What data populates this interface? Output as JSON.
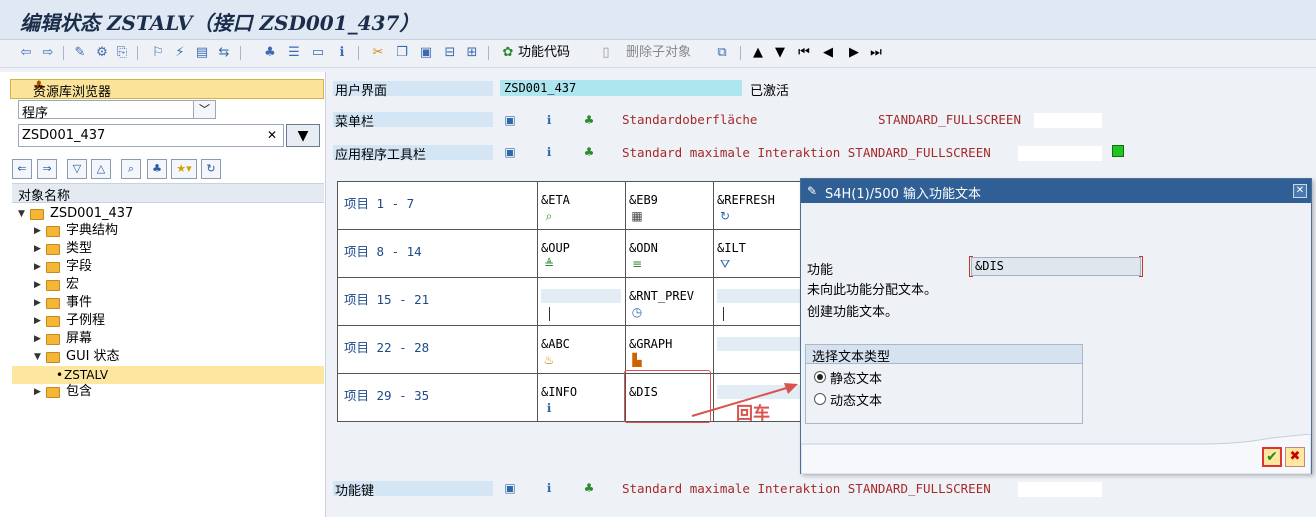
{
  "window": {
    "title": "编辑状态 ZSTALV（接口 ZSD001_437）"
  },
  "toolbar": {
    "function_code_label": "功能代码",
    "delete_child_label": "删除子对象"
  },
  "left": {
    "repo_browser_label": "资源库浏览器",
    "object_type": "程序",
    "object_name": "ZSD001_437",
    "tree_header": "对象名称",
    "tree": [
      {
        "label": "ZSD001_437"
      },
      {
        "label": "字典结构"
      },
      {
        "label": "类型"
      },
      {
        "label": "字段"
      },
      {
        "label": "宏"
      },
      {
        "label": "事件"
      },
      {
        "label": "子例程"
      },
      {
        "label": "屏幕"
      },
      {
        "label": "GUI 状态"
      },
      {
        "label": "ZSTALV"
      },
      {
        "label": "包含"
      }
    ]
  },
  "main": {
    "ui_label": "用户界面",
    "ui_value": "ZSD001_437",
    "ui_status": "已激活",
    "menubar_label": "菜单栏",
    "menubar_text": "Standardoberfläche",
    "menubar_code": "STANDARD_FULLSCREEN",
    "apptoolbar_label": "应用程序工具栏",
    "apptoolbar_text": "Standard maximale Interaktion STANDARD_FULLSCREEN",
    "funckeys_label": "功能键",
    "funckeys_text": "Standard maximale Interaktion STANDARD_FULLSCREEN"
  },
  "grid": {
    "rows": [
      {
        "label": "项目  1 -  7",
        "c1": "&ETA",
        "c2": "&EB9",
        "c3": "&REFRESH"
      },
      {
        "label": "项目  8 - 14",
        "c1": "&OUP",
        "c2": "&ODN",
        "c3": "&ILT"
      },
      {
        "label": "项目 15 - 21",
        "c1": "",
        "c2": "&RNT_PREV",
        "c3": ""
      },
      {
        "label": "项目 22 - 28",
        "c1": "&ABC",
        "c2": "&GRAPH",
        "c3": ""
      },
      {
        "label": "项目 29 - 35",
        "c1": "&INFO",
        "c2": "&DIS",
        "c3": ""
      }
    ]
  },
  "dialog": {
    "title": "S4H(1)/500 输入功能文本",
    "function_label": "功能",
    "function_value": "&DIS",
    "msg1": "未向此功能分配文本。",
    "msg2": "创建功能文本。",
    "group_title": "选择文本类型",
    "radio_static": "静态文本",
    "radio_dynamic": "动态文本"
  },
  "annotation": {
    "text": "回车"
  },
  "colors": {
    "accent_red": "#d9534f",
    "dialog_title_bg": "#2f5f95",
    "active_green": "#22c422"
  }
}
